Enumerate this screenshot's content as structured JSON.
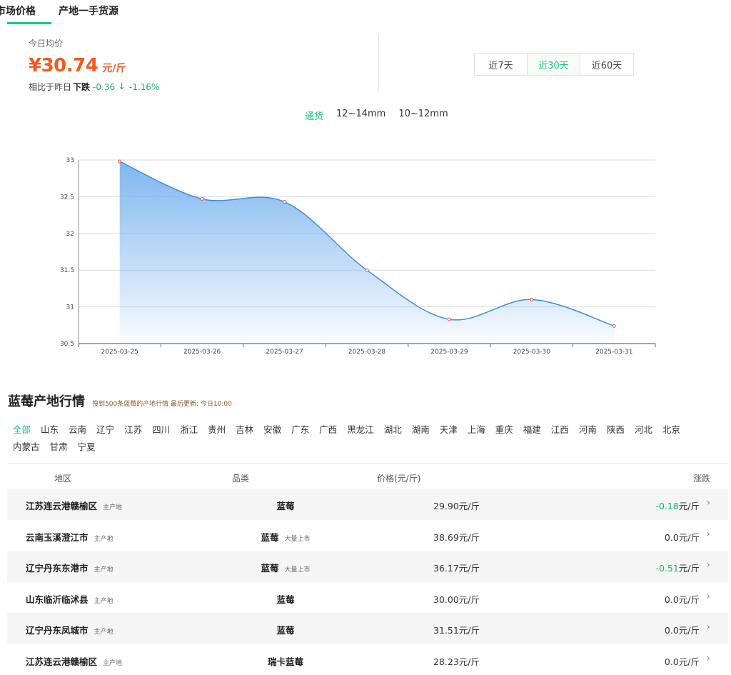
{
  "tabs": [
    {
      "label": "市场价格",
      "active": true
    },
    {
      "label": "产地一手货源",
      "active": false
    }
  ],
  "summary": {
    "today_label": "今日均价",
    "price": "¥30.74",
    "unit": "元/斤",
    "compare_prefix": "相比于昨日",
    "direction": "下跌",
    "delta": "-0.36",
    "arrow": "↓",
    "pct": "-1.16%"
  },
  "range_buttons": [
    "近7天",
    "近30天",
    "近60天"
  ],
  "range_active": 1,
  "specs": [
    "通货",
    "12~14mm",
    "10~12mm"
  ],
  "spec_active": 0,
  "chart_data": {
    "type": "area",
    "x": [
      "2025-03-25",
      "2025-03-26",
      "2025-03-27",
      "2025-03-28",
      "2025-03-29",
      "2025-03-30",
      "2025-03-31"
    ],
    "values": [
      32.98,
      32.47,
      32.43,
      31.5,
      30.83,
      31.1,
      30.74
    ],
    "yticks": [
      30.5,
      31,
      31.5,
      32,
      32.5,
      33
    ],
    "ylim": [
      30.5,
      33
    ],
    "grid": true,
    "line_color": "#3a8fe0",
    "fill_top": "#7fb6f0",
    "marker_color": "#e05050"
  },
  "region": {
    "title": "蓝莓产地行情",
    "meta": "搜到500条蓝莓的产地行情 最后更新: 今日10:00",
    "provinces_row1": [
      "全部",
      "山东",
      "云南",
      "辽宁",
      "江苏",
      "四川",
      "浙江",
      "贵州",
      "吉林",
      "安徽",
      "广东",
      "广西",
      "黑龙江",
      "湖北",
      "湖南",
      "天津",
      "上海",
      "重庆",
      "福建",
      "江西",
      "河南",
      "陕西",
      "河北",
      "北京"
    ],
    "provinces_row2": [
      "内蒙古",
      "甘肃",
      "宁夏"
    ],
    "active": "全部"
  },
  "table": {
    "headers": {
      "region": "地区",
      "variety": "品类",
      "price": "价格(元/斤)",
      "change": "涨跌"
    },
    "rows": [
      {
        "place": "江苏连云港赣榆区",
        "tag": "主产地",
        "variety": "蓝莓",
        "vtag": "",
        "price": "29.90元/斤",
        "change_num": "-0.18",
        "change_unit": "元/斤",
        "neg": true
      },
      {
        "place": "云南玉溪澄江市",
        "tag": "主产地",
        "variety": "蓝莓",
        "vtag": "大量上市",
        "price": "38.69元/斤",
        "change_num": "0.0",
        "change_unit": "元/斤",
        "neg": false
      },
      {
        "place": "辽宁丹东东港市",
        "tag": "主产地",
        "variety": "蓝莓",
        "vtag": "大量上市",
        "price": "36.17元/斤",
        "change_num": "-0.51",
        "change_unit": "元/斤",
        "neg": true
      },
      {
        "place": "山东临沂临沭县",
        "tag": "主产地",
        "variety": "蓝莓",
        "vtag": "",
        "price": "30.00元/斤",
        "change_num": "0.0",
        "change_unit": "元/斤",
        "neg": false
      },
      {
        "place": "辽宁丹东凤城市",
        "tag": "主产地",
        "variety": "蓝莓",
        "vtag": "",
        "price": "31.51元/斤",
        "change_num": "0.0",
        "change_unit": "元/斤",
        "neg": false
      },
      {
        "place": "江苏连云港赣榆区",
        "tag": "主产地",
        "variety": "瑞卡蓝莓",
        "vtag": "",
        "price": "28.23元/斤",
        "change_num": "0.0",
        "change_unit": "元/斤",
        "neg": false
      }
    ]
  }
}
